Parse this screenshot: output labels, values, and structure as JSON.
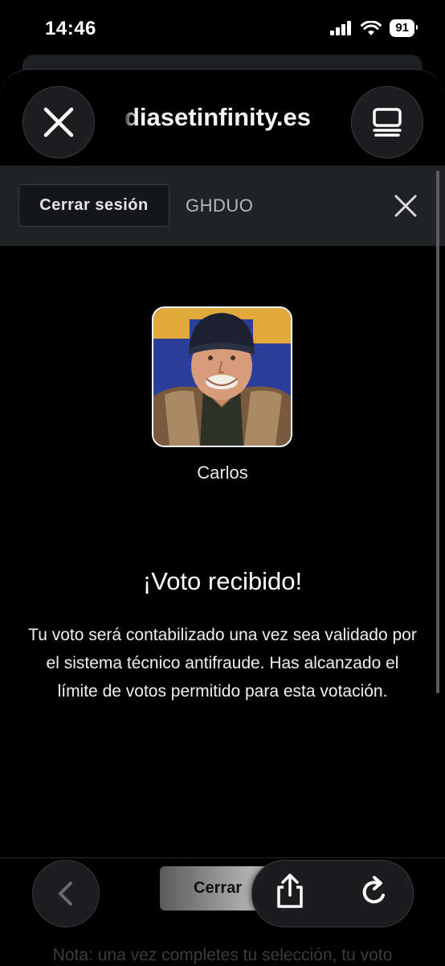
{
  "status_bar": {
    "time": "14:46",
    "battery": "91"
  },
  "browser": {
    "url": "diasetinfinity.es"
  },
  "header": {
    "logout_label": "Cerrar sesión",
    "code": "GHDUO"
  },
  "candidate": {
    "name": "Carlos"
  },
  "result": {
    "title": "¡Voto recibido!",
    "message": "Tu voto será contabilizado una vez sea validado por el sistema técnico antifraude. Has alcanzado el límite de votos permitido para esta votación."
  },
  "footer": {
    "close_label": "Cerrar",
    "note": "Nota: una vez completes tu selección, tu voto"
  },
  "colors": {
    "background": "#000000",
    "header_bar": "#202226",
    "photo_bg": "#2a3e9a"
  }
}
